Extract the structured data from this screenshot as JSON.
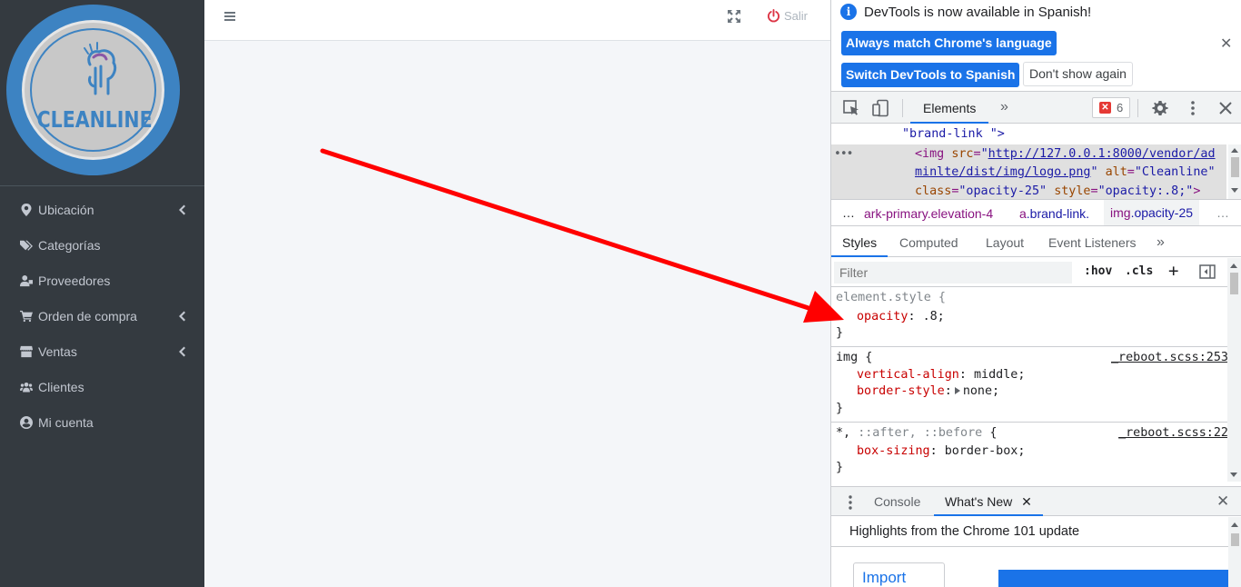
{
  "sidebar": {
    "brand_text": "CLEANLINE",
    "items": [
      {
        "label": "Ubicación",
        "icon": "map-marker-icon",
        "has_children": true
      },
      {
        "label": "Categorías",
        "icon": "tags-icon",
        "has_children": false
      },
      {
        "label": "Proveedores",
        "icon": "user-tie-icon",
        "has_children": false
      },
      {
        "label": "Orden de compra",
        "icon": "cart-plus-icon",
        "has_children": true
      },
      {
        "label": "Ventas",
        "icon": "store-icon",
        "has_children": true
      },
      {
        "label": "Clientes",
        "icon": "users-icon",
        "has_children": false
      },
      {
        "label": "Mi cuenta",
        "icon": "user-circle-icon",
        "has_children": false
      }
    ]
  },
  "topbar": {
    "logout_label": "Salir"
  },
  "devtools": {
    "infobar": {
      "message": "DevTools is now available in Spanish!",
      "btn_match": "Always match Chrome's language",
      "btn_switch": "Switch DevTools to Spanish",
      "btn_dismiss": "Don't show again",
      "close": "✕"
    },
    "toolbar": {
      "tab_elements": "Elements",
      "more_tabs": "»",
      "error_count": "6"
    },
    "dom": {
      "line1": "\"brand-link \">",
      "img_open": "<img",
      "src_attr": "src",
      "src_val_1": "http://127.0.0.1:8000/vendor/ad",
      "src_val_2": "minlte/dist/img/logo.png",
      "alt_attr": "alt",
      "alt_val": "\"Cleanline\"",
      "class_attr": "class",
      "class_val": "\"opacity-25\"",
      "style_attr": "style",
      "style_val": "\"opacity:.8;\"",
      "tag_close": ">",
      "eq": "=",
      "quote": "\"",
      "dots": "•••"
    },
    "breadcrumbs": {
      "ellipsis_left": "…",
      "crumb1": "ark-primary.elevation-4",
      "crumb2_tag": "a",
      "crumb2_cls": ".brand-link.",
      "crumb3_tag": "img",
      "crumb3_cls": ".opacity-25",
      "ellipsis_right": "…"
    },
    "subtabs": [
      "Styles",
      "Computed",
      "Layout",
      "Event Listeners"
    ],
    "subtabs_more": "»",
    "filter": {
      "placeholder": "Filter",
      "hov": ":hov",
      "cls": ".cls",
      "plus": "+"
    },
    "styles": {
      "rule1_selector": "element.style {",
      "rule1_prop": "opacity",
      "rule1_val": ".8;",
      "rule2_selector": "img {",
      "rule2_source": "_reboot.scss:253",
      "rule2_prop1": "vertical-align",
      "rule2_val1": "middle;",
      "rule2_prop2": "border-style",
      "rule2_val2": "none;",
      "rule3_selector_a": "*,",
      "rule3_selector_b": "::after, ::before",
      "rule3_brace": "{",
      "rule3_source": "_reboot.scss:22",
      "rule3_prop": "box-sizing",
      "rule3_val": "border-box;",
      "close_brace": "}",
      "colon": ":"
    },
    "drawer": {
      "tab_console": "Console",
      "tab_whatsnew": "What's New",
      "tab_close": "✕",
      "close": "✕",
      "whatsnew_title": "Highlights from the Chrome 101 update",
      "import_label": "Import"
    }
  },
  "colors": {
    "sidebar_bg": "#343a40",
    "accent_blue": "#1a73e8",
    "arrow_red": "#ff0000",
    "logout_red": "#dc3545"
  }
}
